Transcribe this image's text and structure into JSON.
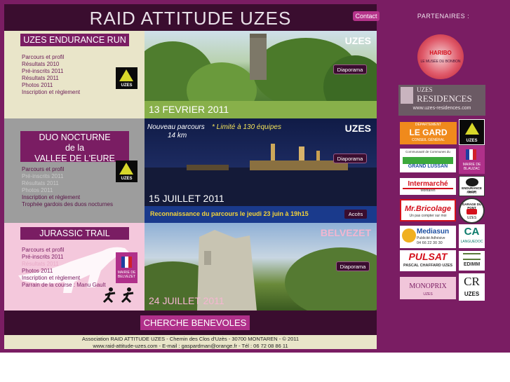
{
  "header": {
    "title": "RAID  ATTITUDE UZES",
    "contact_label": "Contact"
  },
  "sections": [
    {
      "title": "UZES ENDURANCE RUN",
      "links": [
        "Parcours et profil",
        "Résultats 2010",
        "Pré-inscrits 2011",
        "Résultats 2011",
        "Photos 2011",
        "Inscription et règlement"
      ],
      "logo_text": "UZES",
      "photo_place": "UZES",
      "date": "13 FEVRIER 2011",
      "diaporama": "Diaporama"
    },
    {
      "title_lines": [
        "DUO NOCTURNE",
        "de la",
        "VALLEE DE L'EURE"
      ],
      "links": [
        "Parcours et profil",
        "Pré-inscrits 2011",
        "Résultats 2011",
        "Photos 2011",
        "Inscription et règlement",
        "Trophée gardois des duos nocturnes"
      ],
      "logo_text": "UZES",
      "photo_place": "UZES",
      "new_route": "Nouveau parcours",
      "distance": "14 km",
      "limit": "* Limité à 130 équipes",
      "date": "15 JUILLET 2011",
      "diaporama": "Diaporama",
      "recon_text": "Reconnaissance du parcours le jeudi 23 juin à 19h15",
      "acces": "Accès"
    },
    {
      "title": "JURASSIC TRAIL",
      "links": [
        "Parcours et profil",
        "Pré-inscrits 2011",
        "Résultats 2011",
        "Photos 2011",
        "Inscription et règlement",
        "Parrain de la course : Manu Gault"
      ],
      "logo_text": "MAIRIE DE BELVEZET",
      "photo_place": "BELVEZET",
      "date": "24 JUILLET 2011",
      "diaporama": "Diaporama"
    }
  ],
  "benevoles_label": "CHERCHE BENEVOLES",
  "footer": {
    "line1": "Association RAID ATTITUDE UZES - Chemin des Clos d'Uzès - 30700 MONTAREN - © 2011",
    "line2": "www.raid-attitude-uzes.com - E-mail : gaspardman@orange.fr - Tél : 06 72 08 86 11"
  },
  "partners": {
    "title": "PARTENAIRES :",
    "haribo_1": "HARIBO",
    "haribo_2": "LE MUSÉE DU BONBON",
    "uzes_res_1": "UZES",
    "uzes_res_2": "RESIDENCES",
    "uzes_res_url": "www.uzes-residences.com",
    "legard_top": "DÉPARTEMENT",
    "legard": "LE GARD",
    "legard_sub": "CONSEIL GÉNÉRAL",
    "uzes_logo": "UZES",
    "grand_lussan_top": "Communauté de Communes du",
    "grand_lussan": "GRAND LUSSAN",
    "mairie_blauzac": "MAIRIE DE BLAUZAC",
    "intermarche": "Intermarché",
    "intermarche_sub": "Montaren",
    "endurance_shop": "ENDURANCE SHOP",
    "endurance_sub": "NIMES",
    "mr_bricolage": "Mr.Bricolage",
    "mr_bricolage_sub": "Un pas compter sur moi",
    "garage": "GARAGE DU PONT",
    "garage_sub": "UZES",
    "mediasun": "Mediasun",
    "mediasun_sub": "Publicité Adhésive",
    "mediasun_tel": "04 66 22 30 30",
    "ca": "CA",
    "ca_sub": "LANGUEDOC",
    "pulsat": "PULSAT",
    "pulsat_sub": "PASCAL CHAFFARD UZES",
    "edimm": "EDIMM",
    "monoprix": "MONOPRIX",
    "monoprix_sub": "UZES",
    "cr": "CR",
    "cr_sub": "UZES"
  },
  "colors": {
    "frame": "#7a1d63",
    "header": "#3a0d2f",
    "button": "#b0308a",
    "panel1": "#e9e5c9",
    "panel2": "#9d9d9d",
    "panel3": "#f4c8dc"
  }
}
